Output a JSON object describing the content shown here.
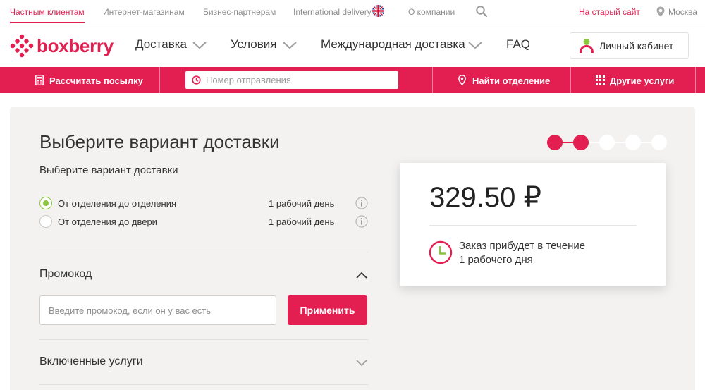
{
  "topbar": {
    "items": [
      {
        "label": "Частным клиентам"
      },
      {
        "label": "Интернет-магазинам"
      },
      {
        "label": "Бизнес-партнерам"
      },
      {
        "label": "International delivery"
      },
      {
        "label": "О компании"
      }
    ],
    "old_site": "На старый сайт",
    "city": "Москва"
  },
  "header": {
    "brand": "boxberry",
    "nav": [
      {
        "label": "Доставка"
      },
      {
        "label": "Условия"
      },
      {
        "label": "Международная доставка"
      },
      {
        "label": "FAQ"
      }
    ],
    "cabinet_label": "Личный кабинет"
  },
  "actionbar": {
    "calc_label": "Рассчитать посылку",
    "tracking_placeholder": "Номер отправления",
    "find_office_label": "Найти отделение",
    "other_services_label": "Другие услуги"
  },
  "main": {
    "title": "Выберите вариант доставки",
    "subtitle": "Выберите вариант доставки",
    "options": [
      {
        "label": "От отделения до отделения",
        "days": "1 рабочий день",
        "selected": true
      },
      {
        "label": "От отделения до двери",
        "days": "1 рабочий день",
        "selected": false
      }
    ],
    "promo": {
      "title": "Промокод",
      "placeholder": "Введите промокод, если он у вас есть",
      "apply_label": "Применить"
    },
    "included_services_title": "Включенные услуги"
  },
  "stepper": {
    "total": 5,
    "current": 2,
    "active_color": "#e31e50"
  },
  "summary": {
    "price": "329.50 ₽",
    "arrival_line1": "Заказ прибудет в течение",
    "arrival_line2": "1 рабочего дня"
  },
  "colors": {
    "brand": "#e31e50",
    "radio_checked": "#8cc63f",
    "clock": "#8cc63f"
  }
}
